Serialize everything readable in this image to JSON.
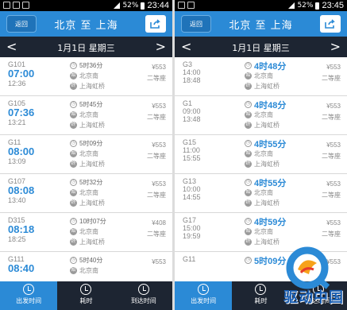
{
  "left": {
    "status": {
      "battery": "52%",
      "time": "23:44"
    },
    "header": {
      "back_label": "返回",
      "title": "北京 至 上海"
    },
    "date_bar": {
      "date": "1月1日 星期三",
      "prev": "<",
      "next": ">"
    },
    "trains": [
      {
        "number": "G101",
        "depart": "07:00",
        "arrive": "12:36",
        "duration": "5时36分",
        "from": "北京南",
        "to": "上海虹桥",
        "price": "¥553",
        "seat": "二等座"
      },
      {
        "number": "G105",
        "depart": "07:36",
        "arrive": "13:21",
        "duration": "5时45分",
        "from": "北京南",
        "to": "上海虹桥",
        "price": "¥553",
        "seat": "二等座"
      },
      {
        "number": "G11",
        "depart": "08:00",
        "arrive": "13:09",
        "duration": "5时09分",
        "from": "北京南",
        "to": "上海虹桥",
        "price": "¥553",
        "seat": "二等座"
      },
      {
        "number": "G107",
        "depart": "08:08",
        "arrive": "13:40",
        "duration": "5时32分",
        "from": "北京南",
        "to": "上海虹桥",
        "price": "¥553",
        "seat": "二等座"
      },
      {
        "number": "D315",
        "depart": "08:18",
        "arrive": "18:25",
        "duration": "10时07分",
        "from": "北京南",
        "to": "上海虹桥",
        "price": "¥408",
        "seat": "二等座"
      },
      {
        "number": "G111",
        "depart": "08:40",
        "arrive": "",
        "duration": "5时40分",
        "from": "北京南",
        "to": "",
        "price": "¥553",
        "seat": ""
      }
    ],
    "tabs": [
      "出发时间",
      "耗时",
      "到达时间"
    ]
  },
  "right": {
    "status": {
      "battery": "52%",
      "time": "23:45"
    },
    "header": {
      "back_label": "返回",
      "title": "北京 至 上海"
    },
    "date_bar": {
      "date": "1月1日 星期三",
      "prev": "<",
      "next": ">"
    },
    "trains": [
      {
        "number": "G3",
        "depart": "14:00",
        "arrive": "18:48",
        "duration": "4时48分",
        "from": "北京南",
        "to": "上海虹桥",
        "price": "¥553",
        "seat": "二等座"
      },
      {
        "number": "G1",
        "depart": "09:00",
        "arrive": "13:48",
        "duration": "4时48分",
        "from": "北京南",
        "to": "上海虹桥",
        "price": "¥553",
        "seat": "二等座"
      },
      {
        "number": "G15",
        "depart": "11:00",
        "arrive": "15:55",
        "duration": "4时55分",
        "from": "北京南",
        "to": "上海虹桥",
        "price": "¥553",
        "seat": "二等座"
      },
      {
        "number": "G13",
        "depart": "10:00",
        "arrive": "14:55",
        "duration": "4时55分",
        "from": "北京南",
        "to": "上海虹桥",
        "price": "¥553",
        "seat": "二等座"
      },
      {
        "number": "G17",
        "depart": "15:00",
        "arrive": "19:59",
        "duration": "4时59分",
        "from": "北京南",
        "to": "上海虹桥",
        "price": "¥553",
        "seat": "二等座"
      },
      {
        "number": "G11",
        "depart": "",
        "arrive": "",
        "duration": "5时09分",
        "from": "",
        "to": "",
        "price": "¥553",
        "seat": ""
      }
    ],
    "tabs": [
      "出发时间",
      "耗时",
      "到达时间"
    ]
  },
  "watermark": "驱动中国",
  "colors": {
    "accent": "#2b8ad6",
    "dark_bar": "#1d2532"
  },
  "icons": {
    "share": "share-icon",
    "clock": "clock-icon",
    "start": "start-station-icon",
    "end": "end-station-icon"
  }
}
